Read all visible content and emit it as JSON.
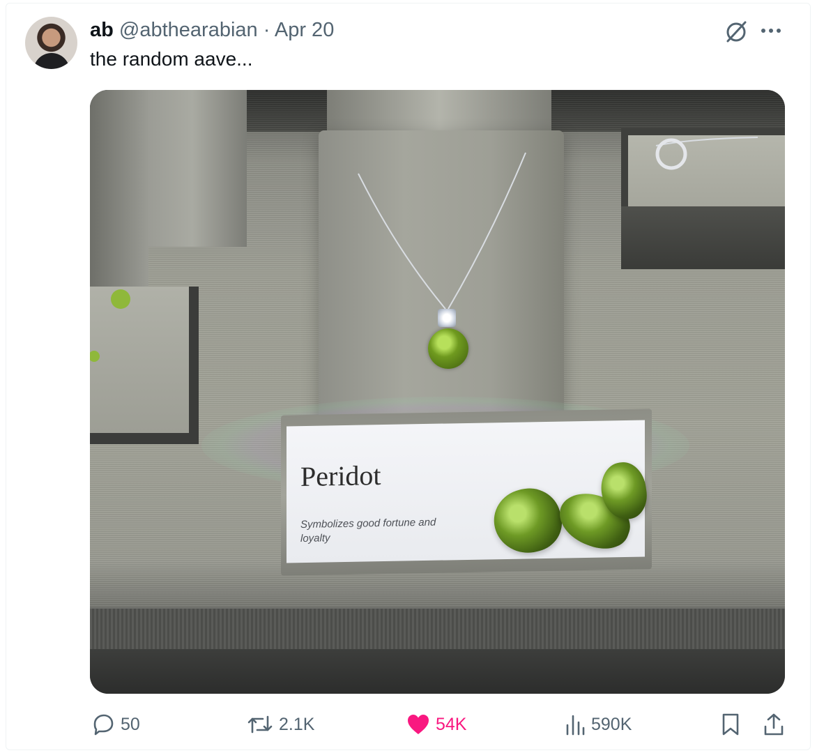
{
  "tweet": {
    "display_name": "ab",
    "handle": "@abthearabian",
    "separator": "·",
    "date": "Apr 20",
    "text": "the random aave...",
    "more_label": "···"
  },
  "image": {
    "sign_title": "Peridot",
    "sign_subtitle": "Symbolizes good fortune and loyalty"
  },
  "actions": {
    "replies": "50",
    "reposts": "2.1K",
    "likes": "54K",
    "views": "590K"
  },
  "colors": {
    "like_active": "#f91880",
    "secondary_text": "#536471",
    "primary_text": "#0f1419"
  },
  "icons": {
    "reply": "reply-icon",
    "repost": "repost-icon",
    "like": "heart-filled-icon",
    "views": "views-icon",
    "bookmark": "bookmark-icon",
    "share": "share-icon",
    "grok": "grok-icon",
    "more": "more-icon"
  }
}
